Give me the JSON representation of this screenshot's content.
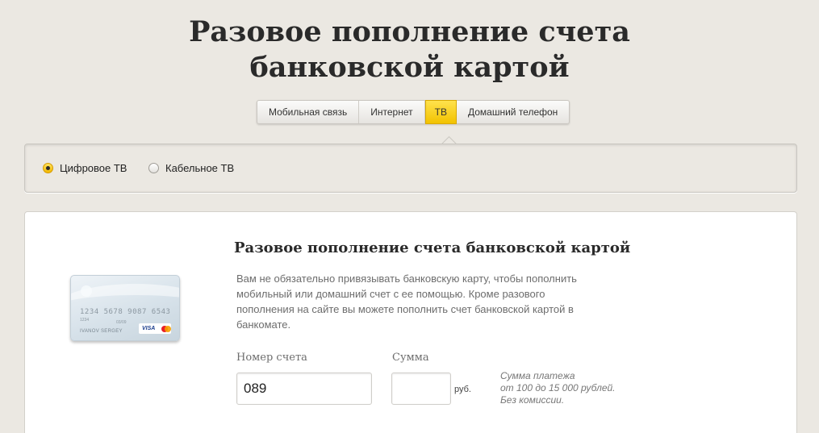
{
  "page": {
    "title_line1": "Разовое пополнение счета",
    "title_line2": "банковской картой"
  },
  "tabs": [
    {
      "label": "Мобильная связь",
      "active": false
    },
    {
      "label": "Интернет",
      "active": false
    },
    {
      "label": "ТВ",
      "active": true
    },
    {
      "label": "Домашний телефон",
      "active": false
    }
  ],
  "tv_type": {
    "options": [
      {
        "label": "Цифровое ТВ",
        "checked": true
      },
      {
        "label": "Кабельное ТВ",
        "checked": false
      }
    ]
  },
  "card_image": {
    "number": "1234 5678 9087 6543",
    "small": "1234",
    "expiry": "03/09",
    "holder": "IVANOV SERGEY",
    "brand": "VISA"
  },
  "form": {
    "title": "Разовое пополнение счета банковской картой",
    "description": "Вам не обязательно привязывать банковскую карту, чтобы пополнить мобильный или домашний счет с ее помощью. Кроме разового пополнения на сайте вы можете пополнить счет банковской картой в банкомате.",
    "account_label": "Номер счета",
    "account_value": "089",
    "amount_label": "Сумма",
    "amount_value": "",
    "currency": "руб.",
    "hint_line1": "Сумма платежа",
    "hint_line2": "от 100 до 15 000 рублей.",
    "hint_line3": "Без комиссии."
  },
  "colors": {
    "background": "#ebe8e2",
    "accent_yellow": "#f2c200",
    "panel": "#ffffff"
  }
}
